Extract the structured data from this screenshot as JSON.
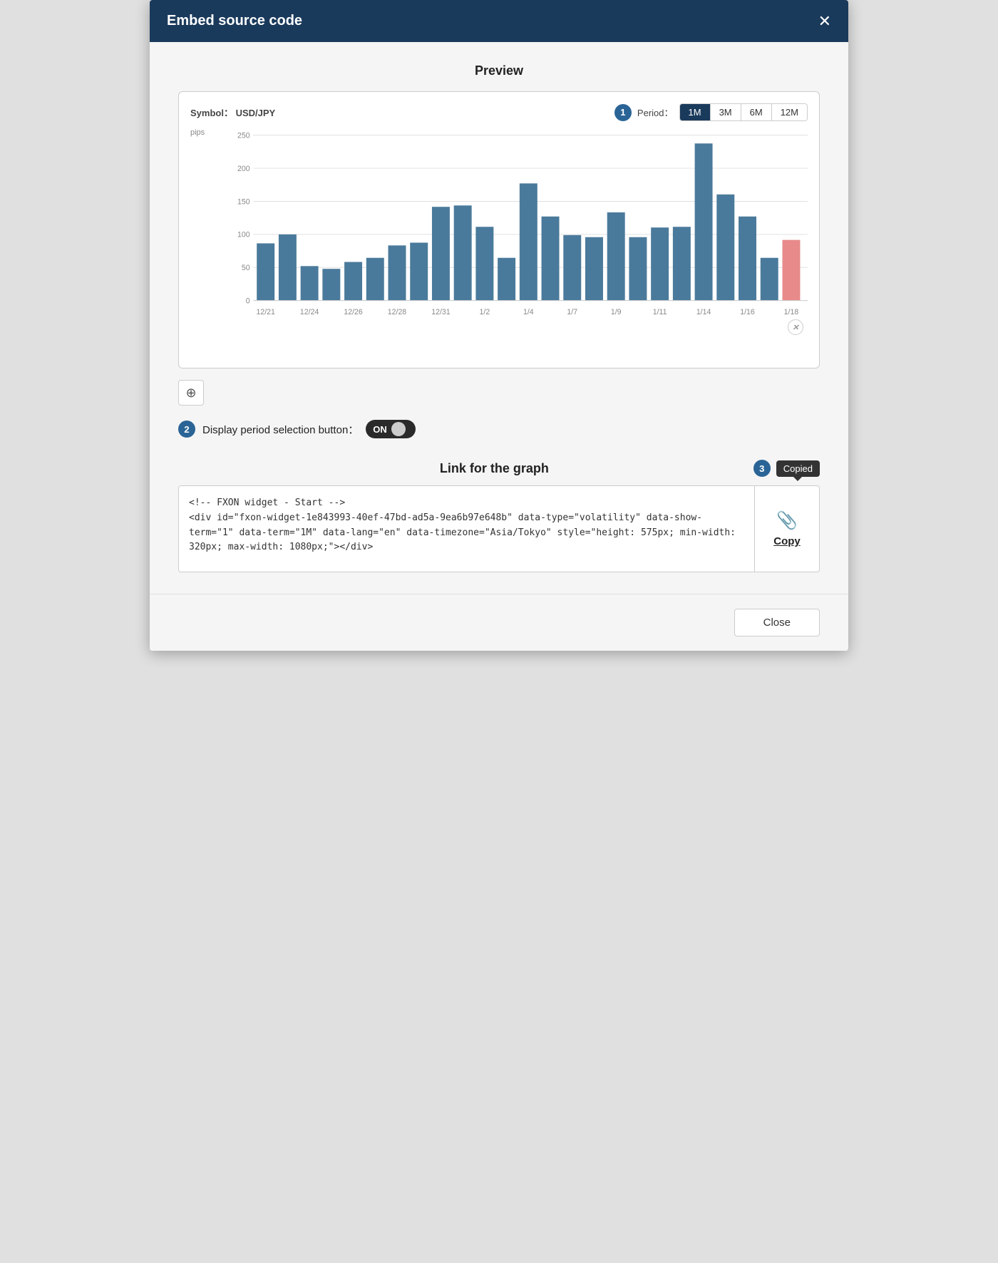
{
  "modal": {
    "title": "Embed source code",
    "close_icon": "✕"
  },
  "preview": {
    "title": "Preview",
    "symbol_label": "Symbol：",
    "symbol_value": "USD/JPY",
    "step_badge": "1",
    "period_label": "Period：",
    "period_buttons": [
      "1M",
      "3M",
      "6M",
      "12M"
    ],
    "active_period": "1M",
    "y_axis_label": "pips",
    "y_ticks": [
      250,
      200,
      150,
      100,
      50,
      0
    ],
    "x_labels": [
      "12/21",
      "12/24",
      "12/26",
      "12/28",
      "12/31",
      "1/2",
      "1/4",
      "1/7",
      "1/9",
      "1/11",
      "1/14",
      "1/16",
      "1/18"
    ],
    "bars": [
      82,
      96,
      50,
      46,
      56,
      62,
      80,
      84,
      136,
      138,
      107,
      62,
      170,
      122,
      95,
      92,
      128,
      92,
      106,
      107,
      228,
      154,
      122,
      62,
      88
    ],
    "highlight_bar_index": 24,
    "highlight_color": "#e88a8a",
    "bar_color": "#4a7a9b",
    "watermark": "✕",
    "zoom_icon": "⊕"
  },
  "toggle": {
    "step_badge": "2",
    "label": "Display period selection button：",
    "state": "ON"
  },
  "link_section": {
    "title": "Link for the graph",
    "step_badge": "3",
    "copied_text": "Copied",
    "code_content": "<!-- FXON widget - Start -->\n<div id=\"fxon-widget-1e843993-40ef-47bd-ad5a-9ea6b97e648b\" data-type=\"volatility\" data-show-term=\"1\" data-term=\"1M\" data-lang=\"en\" data-timezone=\"Asia/Tokyo\" style=\"height: 575px; min-width: 320px; max-width: 1080px;\"></div>",
    "copy_icon": "📎",
    "copy_label": "Copy"
  },
  "footer": {
    "close_label": "Close"
  }
}
